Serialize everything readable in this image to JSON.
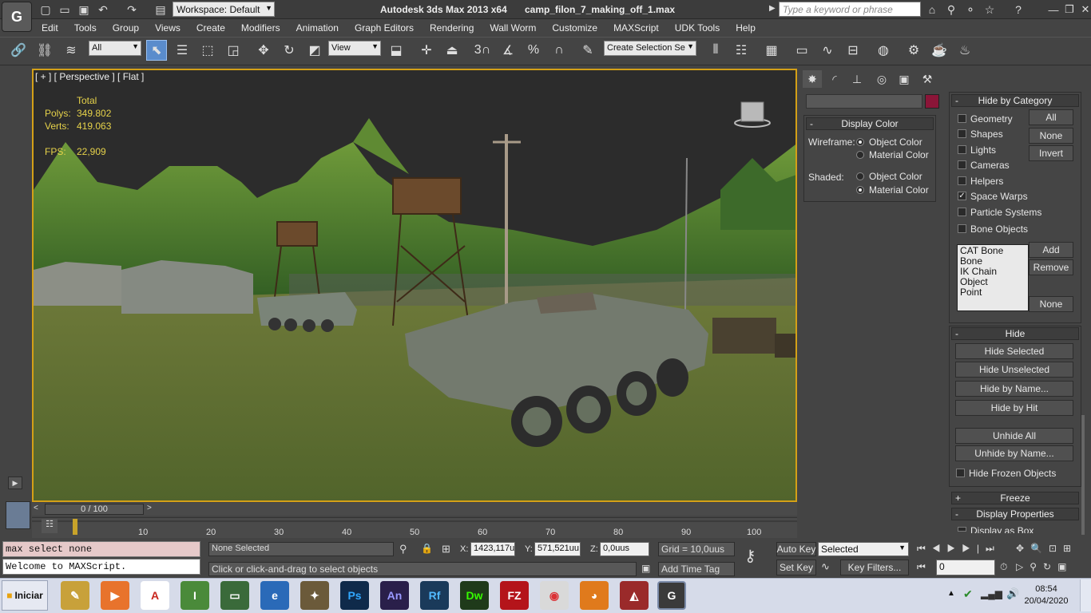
{
  "titlebar": {
    "workspace_label": "Workspace: Default",
    "app_title": "Autodesk 3ds Max  2013 x64",
    "file_name": "camp_filon_7_making_off_1.max",
    "search_placeholder": "Type a keyword or phrase"
  },
  "menubar": {
    "items": [
      "Edit",
      "Tools",
      "Group",
      "Views",
      "Create",
      "Modifiers",
      "Animation",
      "Graph Editors",
      "Rendering",
      "Wall Worm",
      "Customize",
      "MAXScript",
      "UDK Tools",
      "Help"
    ]
  },
  "toolbar": {
    "filter_value": "All",
    "refcoord_value": "View",
    "selection_set_value": "Create Selection Se",
    "snap_3_label": "3",
    "angle_snap_label": "",
    "percent_snap_label": "%"
  },
  "viewport": {
    "label": "[ + ] [ Perspective ] [ Flat ]",
    "stats": {
      "total_label": "Total",
      "polys_label": "Polys:",
      "polys_value": "349.802",
      "verts_label": "Verts:",
      "verts_value": "419.063",
      "fps_label": "FPS:",
      "fps_value": "22,909"
    }
  },
  "display_color": {
    "title": "Display Color",
    "wireframe_label": "Wireframe:",
    "shaded_label": "Shaded:",
    "object_color": "Object Color",
    "material_color": "Material Color"
  },
  "hide_by_category": {
    "title": "Hide by Category",
    "categories": [
      {
        "label": "Geometry",
        "checked": false
      },
      {
        "label": "Shapes",
        "checked": false
      },
      {
        "label": "Lights",
        "checked": false
      },
      {
        "label": "Cameras",
        "checked": false
      },
      {
        "label": "Helpers",
        "checked": false
      },
      {
        "label": "Space Warps",
        "checked": true
      },
      {
        "label": "Particle Systems",
        "checked": false
      },
      {
        "label": "Bone Objects",
        "checked": false
      }
    ],
    "btn_all": "All",
    "btn_none": "None",
    "btn_invert": "Invert",
    "list_items": [
      "CAT Bone",
      "Bone",
      "IK Chain Object",
      "Point"
    ],
    "btn_add": "Add",
    "btn_remove": "Remove",
    "btn_none2": "None"
  },
  "hide": {
    "title": "Hide",
    "hide_selected": "Hide Selected",
    "hide_unselected": "Hide Unselected",
    "hide_by_name": "Hide by Name...",
    "hide_by_hit": "Hide by Hit",
    "unhide_all": "Unhide All",
    "unhide_by_name": "Unhide by Name...",
    "hide_frozen": "Hide Frozen Objects"
  },
  "freeze": {
    "title": "Freeze"
  },
  "display_properties": {
    "title": "Display Properties",
    "display_as_box": "Display as Box"
  },
  "timeline": {
    "frame_readout": "0 / 100",
    "ticks": [
      "10",
      "20",
      "30",
      "40",
      "50",
      "60",
      "70",
      "80",
      "90",
      "100"
    ]
  },
  "status": {
    "maxscript_line1": "max select none",
    "maxscript_line2": "Welcome to MAXScript.",
    "selection": "None Selected",
    "prompt": "Click or click-and-drag to select objects",
    "x_label": "X:",
    "x_value": "1423,117u",
    "y_label": "Y:",
    "y_value": "571,521uu",
    "z_label": "Z:",
    "z_value": "0,0uus",
    "grid": "Grid = 10,0uus",
    "add_time_tag": "Add Time Tag",
    "auto_key": "Auto Key",
    "set_key": "Set Key",
    "selected_dd": "Selected",
    "key_filters": "Key Filters...",
    "frame_field": "0"
  },
  "taskbar": {
    "start_label": "Iniciar",
    "apps": [
      {
        "name": "notes",
        "text": "",
        "color": "#c8a13a"
      },
      {
        "name": "media-player",
        "text": "",
        "color": "#e8732c"
      },
      {
        "name": "pdf",
        "text": "",
        "color": "#c8261e"
      },
      {
        "name": "editor",
        "text": "",
        "color": "#4a8a3a"
      },
      {
        "name": "monitor",
        "text": "",
        "color": "#3a6a3a"
      },
      {
        "name": "browser-ie",
        "text": "",
        "color": "#2a6ab8"
      },
      {
        "name": "rifle",
        "text": "",
        "color": "#6b5a3a"
      },
      {
        "name": "photoshop",
        "text": "Ps",
        "color": "#0f2a4a"
      },
      {
        "name": "animate",
        "text": "An",
        "color": "#2a1f4a"
      },
      {
        "name": "reflow",
        "text": "Rf",
        "color": "#1a3a5a"
      },
      {
        "name": "dreamweaver",
        "text": "Dw",
        "color": "#1f3a1a"
      },
      {
        "name": "filezilla",
        "text": "FZ",
        "color": "#b4141a"
      },
      {
        "name": "chrome",
        "text": "",
        "color": "#d9d9d9"
      },
      {
        "name": "firefox",
        "text": "",
        "color": "#e07a1c"
      },
      {
        "name": "cake",
        "text": "",
        "color": "#9a2a2a"
      },
      {
        "name": "3dsmax",
        "text": "",
        "color": "#3a3a3a"
      }
    ],
    "time": "08:54",
    "date": "20/04/2020"
  }
}
